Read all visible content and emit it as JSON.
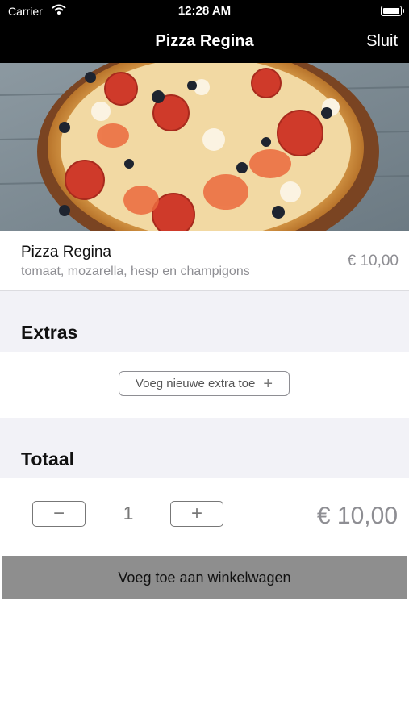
{
  "status_bar": {
    "carrier": "Carrier",
    "time": "12:28 AM"
  },
  "nav": {
    "title": "Pizza Regina",
    "close_label": "Sluit"
  },
  "product": {
    "name": "Pizza Regina",
    "description": "tomaat, mozarella, hesp en champigons",
    "price": "€ 10,00"
  },
  "extras": {
    "title": "Extras",
    "add_label": "Voeg nieuwe extra toe"
  },
  "total": {
    "title": "Totaal",
    "decrement_label": "−",
    "quantity": "1",
    "increment_label": "+",
    "price": "€ 10,00"
  },
  "cart": {
    "add_label": "Voeg toe aan winkelwagen"
  },
  "colors": {
    "bar_background": "#000000",
    "section_background": "#f2f2f7",
    "secondary_text": "#8e8e93",
    "cart_button": "#8e8e8e"
  }
}
